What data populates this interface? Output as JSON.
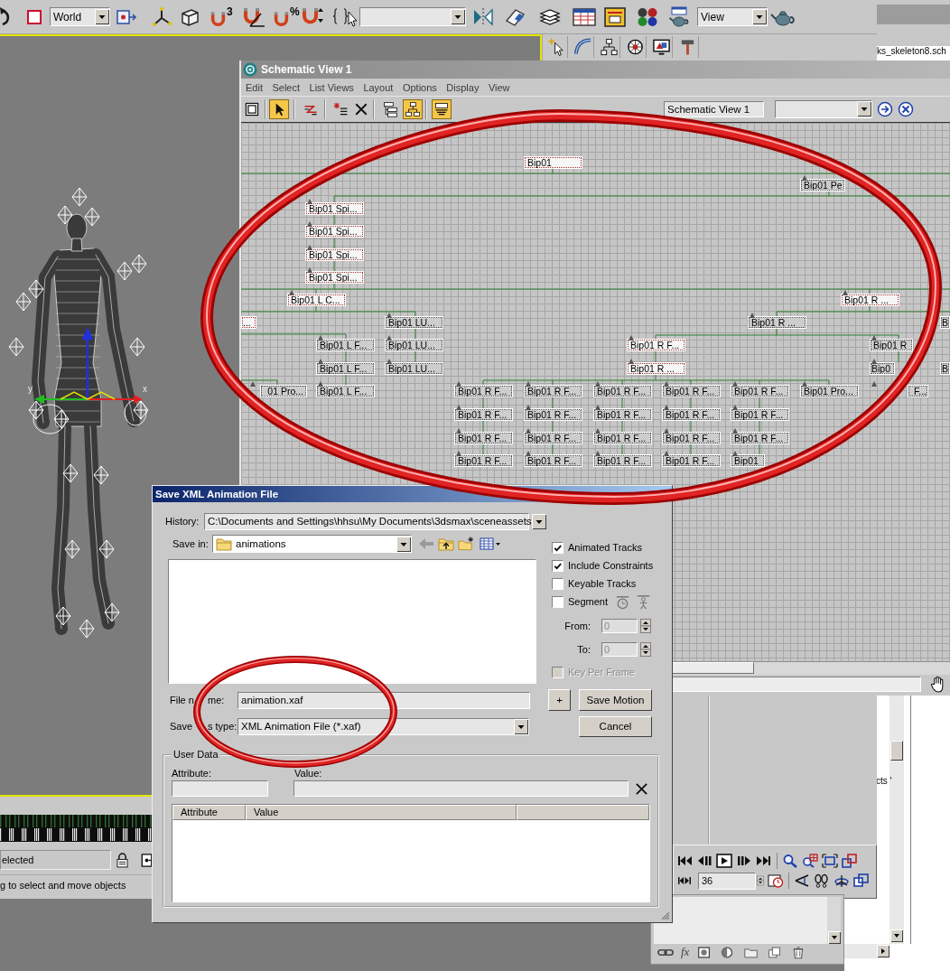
{
  "main_toolbar": {
    "coordinate_system": "World",
    "snap_label": "3",
    "percent_label": "%",
    "view": "View"
  },
  "side_window": {
    "file": "ks_skeleton8.sch"
  },
  "viewport": {
    "axis_labels": [
      "y",
      "x"
    ]
  },
  "command_panel": {
    "tabs": [
      {
        "kind": "create"
      },
      {
        "kind": "modify"
      },
      {
        "kind": "hierarchy"
      },
      {
        "kind": "motion"
      },
      {
        "kind": "display"
      },
      {
        "kind": "utilities"
      }
    ]
  },
  "status_bar": {
    "selection": "elected",
    "prompt": "g to select and move objects"
  },
  "time_controls": {
    "frame": "36"
  },
  "text_window": {
    "text": "cts '"
  },
  "modifier_panel": {
    "fx_label": "fx"
  },
  "schematic": {
    "title": "Schematic View 1",
    "menus": [
      "Edit",
      "Select",
      "List Views",
      "Layout",
      "Options",
      "Display",
      "View"
    ],
    "tools": [
      {
        "kind": "display-floater",
        "selected": false
      },
      {
        "kind": "select",
        "selected": true
      },
      {
        "kind": "connect",
        "selected": false
      },
      {
        "kind": "add-node",
        "selected": false
      },
      {
        "kind": "delete",
        "selected": false
      },
      {
        "kind": "hierarchy-mode",
        "selected": false
      },
      {
        "kind": "references-mode",
        "selected": true
      },
      {
        "kind": "filter",
        "selected": true
      }
    ],
    "view_name": "Schematic View 1",
    "nodes": [
      {
        "label": "Bip01",
        "selected": true,
        "parent_marker": false
      },
      {
        "label": "Bip01 Pe",
        "selected": false,
        "parent_marker": true
      },
      {
        "label": "Bip01 Spi...",
        "selected": true,
        "parent_marker": true
      },
      {
        "label": "Bip01 Spi...",
        "selected": true,
        "parent_marker": true
      },
      {
        "label": "Bip01 Spi...",
        "selected": true,
        "parent_marker": true
      },
      {
        "label": "Bip01 Spi...",
        "selected": true,
        "parent_marker": true
      },
      {
        "label": "Bip01 L C...",
        "selected": true,
        "parent_marker": true
      },
      {
        "label": "Bip01 R ...",
        "selected": true,
        "parent_marker": true
      },
      {
        "label": "...",
        "selected": true,
        "parent_marker": false
      },
      {
        "label": "Bip01 LU...",
        "selected": false,
        "parent_marker": true
      },
      {
        "label": "Bip01 R ...",
        "selected": false,
        "parent_marker": true
      },
      {
        "label": "B",
        "selected": false,
        "parent_marker": false
      },
      {
        "label": "Bip01 L F...",
        "selected": false,
        "parent_marker": true
      },
      {
        "label": "Bip01 LU...",
        "selected": false,
        "parent_marker": true
      },
      {
        "label": "Bip01 R F...",
        "selected": true,
        "parent_marker": true
      },
      {
        "label": "Bip01 R",
        "selected": false,
        "parent_marker": true
      },
      {
        "label": "Bip01 L F...",
        "selected": false,
        "parent_marker": true
      },
      {
        "label": "Bip01 LU...",
        "selected": false,
        "parent_marker": true
      },
      {
        "label": "Bip01 R ...",
        "selected": true,
        "parent_marker": true
      },
      {
        "label": "Bip0",
        "selected": false,
        "parent_marker": true
      },
      {
        "label": "B",
        "selected": false,
        "parent_marker": false
      },
      {
        "label": "01 Pro...",
        "selected": false,
        "parent_marker": true
      },
      {
        "label": "Bip01 L F...",
        "selected": false,
        "parent_marker": true
      },
      {
        "label": "Bip01 R F...",
        "selected": false,
        "parent_marker": true
      },
      {
        "label": "Bip01 R F...",
        "selected": false,
        "parent_marker": true
      },
      {
        "label": "Bip01 R F...",
        "selected": false,
        "parent_marker": true
      },
      {
        "label": "Bip01 R F...",
        "selected": false,
        "parent_marker": true
      },
      {
        "label": "Bip01 R F...",
        "selected": false,
        "parent_marker": true
      },
      {
        "label": "Bip01 Pro...",
        "selected": false,
        "parent_marker": true
      },
      {
        "label": "F...",
        "selected": false,
        "parent_marker": true
      },
      {
        "label": "Bip01 R F...",
        "selected": false,
        "parent_marker": true
      },
      {
        "label": "Bip01 R F...",
        "selected": false,
        "parent_marker": true
      },
      {
        "label": "Bip01 R F...",
        "selected": false,
        "parent_marker": true
      },
      {
        "label": "Bip01 R F...",
        "selected": false,
        "parent_marker": true
      },
      {
        "label": "Bip01 R F...",
        "selected": false,
        "parent_marker": true
      },
      {
        "label": "Bip01 R F...",
        "selected": false,
        "parent_marker": true
      },
      {
        "label": "Bip01 R F...",
        "selected": false,
        "parent_marker": true
      },
      {
        "label": "Bip01 R F...",
        "selected": false,
        "parent_marker": true
      },
      {
        "label": "Bip01 R F...",
        "selected": false,
        "parent_marker": true
      },
      {
        "label": "Bip01 R F...",
        "selected": false,
        "parent_marker": true
      },
      {
        "label": "Bip01 R F...",
        "selected": false,
        "parent_marker": true
      },
      {
        "label": "Bip01 R F...",
        "selected": false,
        "parent_marker": true
      },
      {
        "label": "Bip01 R F...",
        "selected": false,
        "parent_marker": true
      },
      {
        "label": "Bip01 R F...",
        "selected": false,
        "parent_marker": true
      },
      {
        "label": "Bip01",
        "selected": false,
        "parent_marker": true
      }
    ]
  },
  "dialog": {
    "title": "Save XML Animation File",
    "history_label": "History:",
    "history": "C:\\Documents and Settings\\hhsu\\My Documents\\3dsmax\\sceneassets",
    "save_in_label": "Save in:",
    "save_in": "animations",
    "options": [
      {
        "kind": "plain",
        "label": "Animated Tracks",
        "checked": true
      },
      {
        "kind": "plain",
        "label": "Include Constraints",
        "checked": true
      },
      {
        "kind": "plain",
        "label": "Keyable Tracks",
        "checked": false
      },
      {
        "kind": "segment",
        "label": "Segment",
        "checked": false
      }
    ],
    "range": {
      "disabled": true,
      "from_label": "From:",
      "from": "0",
      "to_label": "To:",
      "to": "0"
    },
    "key_per_frame": {
      "label": "Key Per Frame",
      "checked": false,
      "disabled": true
    },
    "file_name_label": [
      "File n",
      "me:"
    ],
    "file_name": "animation.xaf",
    "save_type_label": [
      "Save",
      "s type:"
    ],
    "save_type": "XML Animation File (*.xaf)",
    "add_button": "+",
    "save_button": "Save Motion",
    "cancel_button": "Cancel",
    "user_data": {
      "title": "User Data",
      "attribute_label": "Attribute:",
      "value_label": "Value:",
      "columns": [
        "Attribute",
        "Value"
      ]
    }
  },
  "annotations": [
    {
      "kind": "ring"
    },
    {
      "kind": "ring"
    }
  ]
}
